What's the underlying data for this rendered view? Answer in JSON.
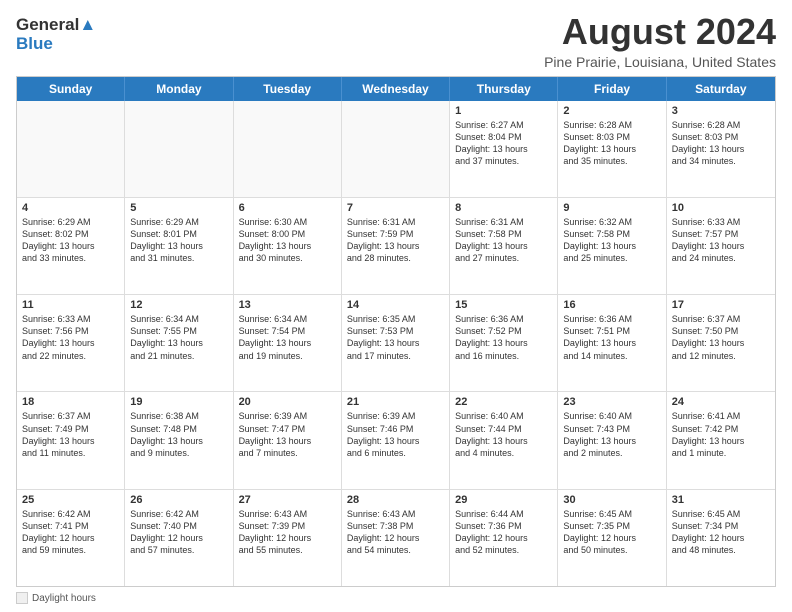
{
  "header": {
    "logo_line1": "General",
    "logo_line2": "Blue",
    "main_title": "August 2024",
    "subtitle": "Pine Prairie, Louisiana, United States"
  },
  "calendar": {
    "days_of_week": [
      "Sunday",
      "Monday",
      "Tuesday",
      "Wednesday",
      "Thursday",
      "Friday",
      "Saturday"
    ],
    "weeks": [
      [
        {
          "day": "",
          "text": "",
          "empty": true
        },
        {
          "day": "",
          "text": "",
          "empty": true
        },
        {
          "day": "",
          "text": "",
          "empty": true
        },
        {
          "day": "",
          "text": "",
          "empty": true
        },
        {
          "day": "1",
          "text": "Sunrise: 6:27 AM\nSunset: 8:04 PM\nDaylight: 13 hours\nand 37 minutes.",
          "empty": false
        },
        {
          "day": "2",
          "text": "Sunrise: 6:28 AM\nSunset: 8:03 PM\nDaylight: 13 hours\nand 35 minutes.",
          "empty": false
        },
        {
          "day": "3",
          "text": "Sunrise: 6:28 AM\nSunset: 8:03 PM\nDaylight: 13 hours\nand 34 minutes.",
          "empty": false
        }
      ],
      [
        {
          "day": "4",
          "text": "Sunrise: 6:29 AM\nSunset: 8:02 PM\nDaylight: 13 hours\nand 33 minutes.",
          "empty": false
        },
        {
          "day": "5",
          "text": "Sunrise: 6:29 AM\nSunset: 8:01 PM\nDaylight: 13 hours\nand 31 minutes.",
          "empty": false
        },
        {
          "day": "6",
          "text": "Sunrise: 6:30 AM\nSunset: 8:00 PM\nDaylight: 13 hours\nand 30 minutes.",
          "empty": false
        },
        {
          "day": "7",
          "text": "Sunrise: 6:31 AM\nSunset: 7:59 PM\nDaylight: 13 hours\nand 28 minutes.",
          "empty": false
        },
        {
          "day": "8",
          "text": "Sunrise: 6:31 AM\nSunset: 7:58 PM\nDaylight: 13 hours\nand 27 minutes.",
          "empty": false
        },
        {
          "day": "9",
          "text": "Sunrise: 6:32 AM\nSunset: 7:58 PM\nDaylight: 13 hours\nand 25 minutes.",
          "empty": false
        },
        {
          "day": "10",
          "text": "Sunrise: 6:33 AM\nSunset: 7:57 PM\nDaylight: 13 hours\nand 24 minutes.",
          "empty": false
        }
      ],
      [
        {
          "day": "11",
          "text": "Sunrise: 6:33 AM\nSunset: 7:56 PM\nDaylight: 13 hours\nand 22 minutes.",
          "empty": false
        },
        {
          "day": "12",
          "text": "Sunrise: 6:34 AM\nSunset: 7:55 PM\nDaylight: 13 hours\nand 21 minutes.",
          "empty": false
        },
        {
          "day": "13",
          "text": "Sunrise: 6:34 AM\nSunset: 7:54 PM\nDaylight: 13 hours\nand 19 minutes.",
          "empty": false
        },
        {
          "day": "14",
          "text": "Sunrise: 6:35 AM\nSunset: 7:53 PM\nDaylight: 13 hours\nand 17 minutes.",
          "empty": false
        },
        {
          "day": "15",
          "text": "Sunrise: 6:36 AM\nSunset: 7:52 PM\nDaylight: 13 hours\nand 16 minutes.",
          "empty": false
        },
        {
          "day": "16",
          "text": "Sunrise: 6:36 AM\nSunset: 7:51 PM\nDaylight: 13 hours\nand 14 minutes.",
          "empty": false
        },
        {
          "day": "17",
          "text": "Sunrise: 6:37 AM\nSunset: 7:50 PM\nDaylight: 13 hours\nand 12 minutes.",
          "empty": false
        }
      ],
      [
        {
          "day": "18",
          "text": "Sunrise: 6:37 AM\nSunset: 7:49 PM\nDaylight: 13 hours\nand 11 minutes.",
          "empty": false
        },
        {
          "day": "19",
          "text": "Sunrise: 6:38 AM\nSunset: 7:48 PM\nDaylight: 13 hours\nand 9 minutes.",
          "empty": false
        },
        {
          "day": "20",
          "text": "Sunrise: 6:39 AM\nSunset: 7:47 PM\nDaylight: 13 hours\nand 7 minutes.",
          "empty": false
        },
        {
          "day": "21",
          "text": "Sunrise: 6:39 AM\nSunset: 7:46 PM\nDaylight: 13 hours\nand 6 minutes.",
          "empty": false
        },
        {
          "day": "22",
          "text": "Sunrise: 6:40 AM\nSunset: 7:44 PM\nDaylight: 13 hours\nand 4 minutes.",
          "empty": false
        },
        {
          "day": "23",
          "text": "Sunrise: 6:40 AM\nSunset: 7:43 PM\nDaylight: 13 hours\nand 2 minutes.",
          "empty": false
        },
        {
          "day": "24",
          "text": "Sunrise: 6:41 AM\nSunset: 7:42 PM\nDaylight: 13 hours\nand 1 minute.",
          "empty": false
        }
      ],
      [
        {
          "day": "25",
          "text": "Sunrise: 6:42 AM\nSunset: 7:41 PM\nDaylight: 12 hours\nand 59 minutes.",
          "empty": false
        },
        {
          "day": "26",
          "text": "Sunrise: 6:42 AM\nSunset: 7:40 PM\nDaylight: 12 hours\nand 57 minutes.",
          "empty": false
        },
        {
          "day": "27",
          "text": "Sunrise: 6:43 AM\nSunset: 7:39 PM\nDaylight: 12 hours\nand 55 minutes.",
          "empty": false
        },
        {
          "day": "28",
          "text": "Sunrise: 6:43 AM\nSunset: 7:38 PM\nDaylight: 12 hours\nand 54 minutes.",
          "empty": false
        },
        {
          "day": "29",
          "text": "Sunrise: 6:44 AM\nSunset: 7:36 PM\nDaylight: 12 hours\nand 52 minutes.",
          "empty": false
        },
        {
          "day": "30",
          "text": "Sunrise: 6:45 AM\nSunset: 7:35 PM\nDaylight: 12 hours\nand 50 minutes.",
          "empty": false
        },
        {
          "day": "31",
          "text": "Sunrise: 6:45 AM\nSunset: 7:34 PM\nDaylight: 12 hours\nand 48 minutes.",
          "empty": false
        }
      ]
    ]
  },
  "footer": {
    "legend_label": "Daylight hours"
  }
}
